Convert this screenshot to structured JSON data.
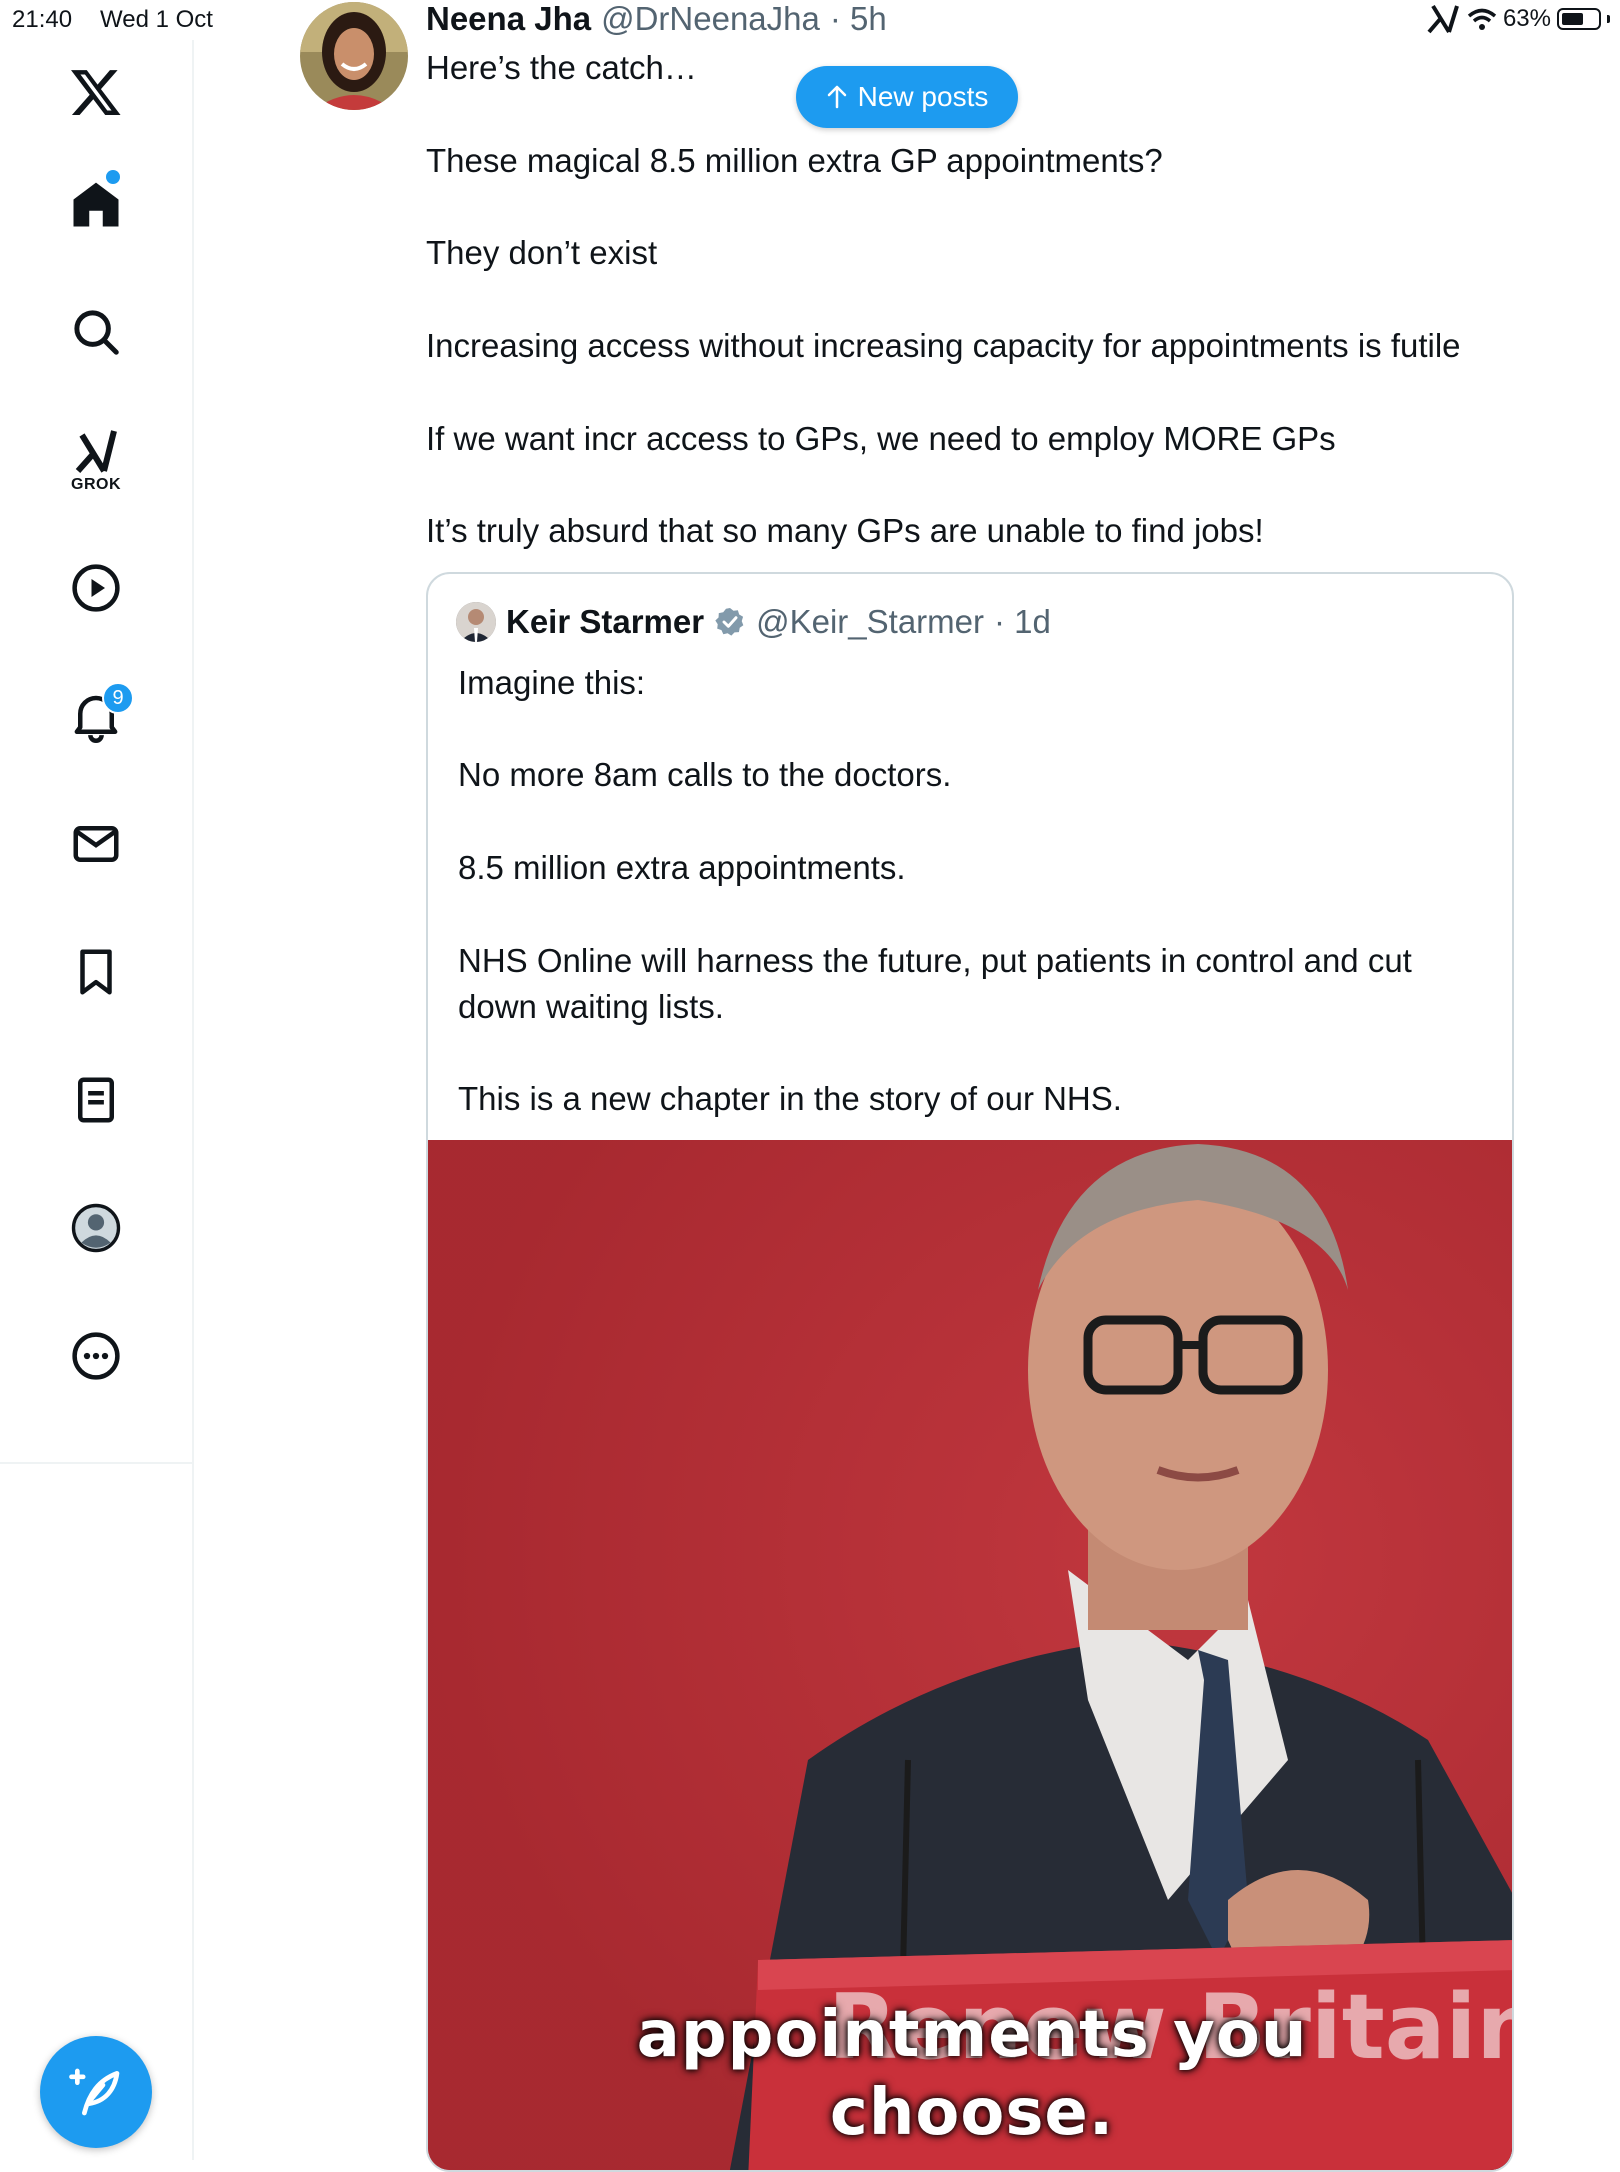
{
  "status_bar": {
    "time": "21:40",
    "date": "Wed 1 Oct",
    "battery": "63%",
    "battery_level": 0.63
  },
  "sidebar": {
    "items": [
      {
        "name": "x-logo",
        "label": ""
      },
      {
        "name": "home",
        "label": ""
      },
      {
        "name": "explore",
        "label": ""
      },
      {
        "name": "grok",
        "label": "GROK"
      },
      {
        "name": "videos",
        "label": ""
      },
      {
        "name": "notifications",
        "label": "",
        "badge": "9"
      },
      {
        "name": "messages",
        "label": ""
      },
      {
        "name": "bookmarks",
        "label": ""
      },
      {
        "name": "lists",
        "label": ""
      },
      {
        "name": "profile",
        "label": ""
      },
      {
        "name": "more",
        "label": ""
      }
    ]
  },
  "post": {
    "author_name": "Neena Jha",
    "author_handle": "@DrNeenaJha",
    "time": "5h",
    "paragraphs": [
      "Here’s the catch…",
      "These magical 8.5 million extra GP appointments?",
      "They don’t exist",
      "Increasing access without increasing capacity for appointments is futile",
      "If we want incr access to GPs, we need to employ MORE GPs",
      "It’s truly absurd that so many GPs are unable to find jobs!"
    ]
  },
  "new_posts": {
    "label": "New posts"
  },
  "quote": {
    "author_name": "Keir Starmer",
    "author_handle": "@Keir_Starmer",
    "time": "1d",
    "paragraphs": [
      "Imagine this:",
      "No more 8am calls to the doctors.",
      "8.5 million extra appointments.",
      "NHS Online will harness the future, put patients in control and cut down waiting lists.",
      "This is a new chapter in the story of our NHS."
    ],
    "media": {
      "podium_text": "Renew Britain",
      "caption_line1": "appointments you",
      "caption_line2": "choose."
    }
  },
  "colors": {
    "accent": "#1d9bf0",
    "media_background": "#b32c33",
    "text": "#0f1419",
    "secondary": "#536471"
  }
}
